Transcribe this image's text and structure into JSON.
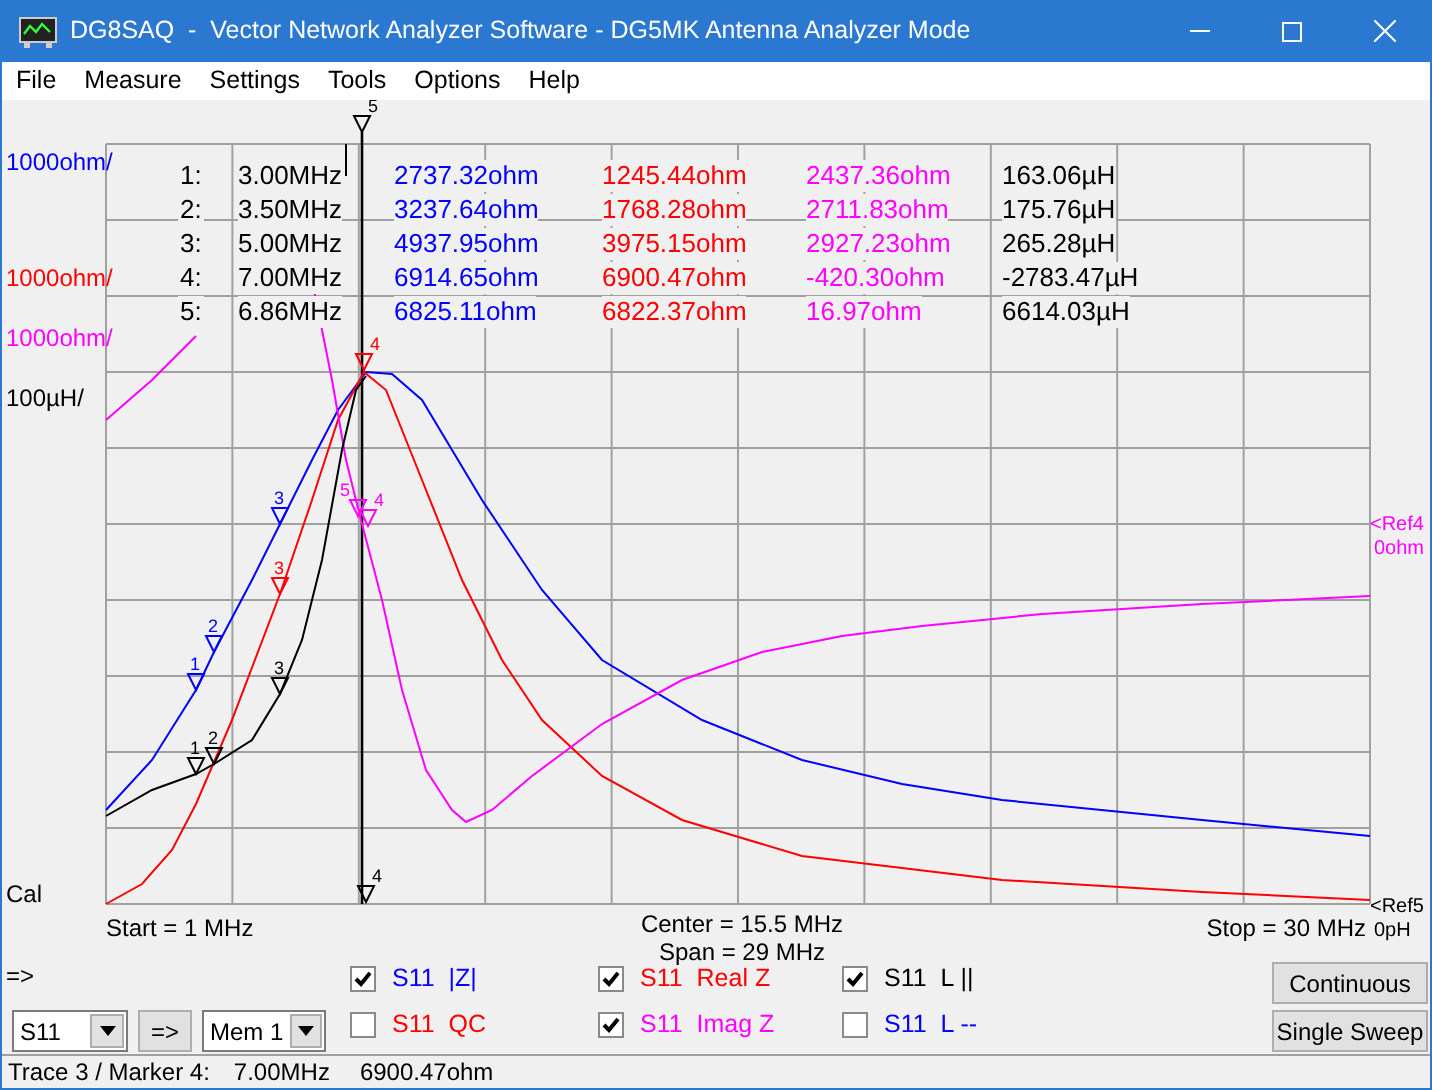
{
  "window": {
    "title": "DG8SAQ  -  Vector Network Analyzer Software - DG5MK Antenna Analyzer Mode"
  },
  "menu": [
    "File",
    "Measure",
    "Settings",
    "Tools",
    "Options",
    "Help"
  ],
  "plot": {
    "top_marker": "5",
    "left_labels": [
      {
        "text": "1000ohm/",
        "color": "#0000ff"
      },
      {
        "text": "1000ohm/",
        "color": "#ff0000"
      },
      {
        "text": "1000ohm/",
        "color": "#ff00ff"
      },
      {
        "text": "100µH/",
        "color": "#000000"
      }
    ],
    "cal": "Cal",
    "ref_labels": [
      {
        "text": "<Ref4",
        "value": "0ohm",
        "color": "#ff00ff"
      },
      {
        "text": "<Ref5",
        "value": "0pH",
        "color": "#000000"
      }
    ],
    "traces": [
      {
        "color": "#0000ff",
        "markers": [
          "1",
          "2",
          "3"
        ]
      },
      {
        "color": "#ff0000",
        "markers": [
          "3",
          "4"
        ]
      },
      {
        "color": "#ff00ff",
        "markers": [
          "5",
          "4"
        ]
      },
      {
        "color": "#000000",
        "markers": [
          "1",
          "2",
          "3",
          "4"
        ]
      }
    ],
    "start": "Start = 1 MHz",
    "center": "Center = 15.5 MHz",
    "span": "Span = 29 MHz",
    "stop": "Stop = 30 MHz"
  },
  "marker_table": {
    "columns": [
      {
        "color": "#0000ff"
      },
      {
        "color": "#ff0000"
      },
      {
        "color": "#ff00ff"
      },
      {
        "color": "#000000"
      }
    ],
    "rows": [
      {
        "index": "1:",
        "frequency": "3.00MHz",
        "values": [
          "2737.32ohm",
          "1245.44ohm",
          "2437.36ohm",
          "163.06µH"
        ]
      },
      {
        "index": "2:",
        "frequency": "3.50MHz",
        "values": [
          "3237.64ohm",
          "1768.28ohm",
          "2711.83ohm",
          "175.76µH"
        ]
      },
      {
        "index": "3:",
        "frequency": "5.00MHz",
        "values": [
          "4937.95ohm",
          "3975.15ohm",
          "2927.23ohm",
          "265.28µH"
        ]
      },
      {
        "index": "4:",
        "frequency": "7.00MHz",
        "values": [
          "6914.65ohm",
          "6900.47ohm",
          "-420.30ohm",
          "-2783.47µH"
        ]
      },
      {
        "index": "5:",
        "frequency": "6.86MHz",
        "values": [
          "6825.11ohm",
          "6822.37ohm",
          "16.97ohm",
          "6614.03µH"
        ]
      }
    ]
  },
  "arrow_label": "=>",
  "controls": {
    "trace_select": "S11",
    "copy_button": "=>",
    "memory_select": "Mem 1"
  },
  "trace_checkboxes": [
    {
      "label": "S11  |Z|",
      "color": "#0000ff",
      "checked": true
    },
    {
      "label": "S11  QC",
      "color": "#ff0000",
      "checked": false
    },
    {
      "label": "S11  Real Z",
      "color": "#ff0000",
      "checked": true
    },
    {
      "label": "S11  Imag Z",
      "color": "#ff00ff",
      "checked": true
    },
    {
      "label": "S11  L ||",
      "color": "#000000",
      "checked": true
    },
    {
      "label": "S11  L --",
      "color": "#0000ff",
      "checked": false
    }
  ],
  "buttons": [
    "Continuous",
    "Single Sweep"
  ],
  "status_bar": {
    "trace_marker": "Trace 3 / Marker 4:",
    "frequency": "7.00MHz",
    "value": "6900.47ohm"
  }
}
